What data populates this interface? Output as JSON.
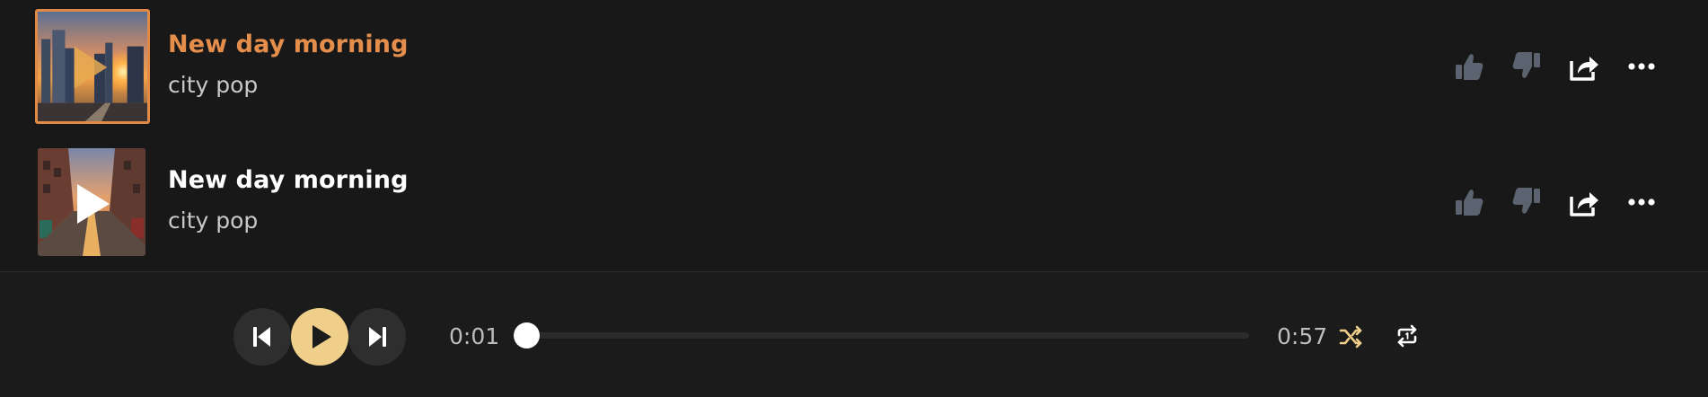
{
  "tracks": [
    {
      "title": "New day morning",
      "subtitle": "city pop",
      "active": true,
      "thumbnail_icon": "sunset-city-skyline-art"
    },
    {
      "title": "New day morning",
      "subtitle": "city pop",
      "active": false,
      "thumbnail_icon": "sunset-street-art"
    }
  ],
  "row_actions": [
    "thumbs-up-icon",
    "thumbs-down-icon",
    "share-icon",
    "more-icon"
  ],
  "player": {
    "current_time": "0:01",
    "total_time": "0:57",
    "progress_fraction": 0.0,
    "buttons": [
      "previous-icon",
      "play-icon",
      "next-icon"
    ],
    "shuffle_icon": "shuffle-icon",
    "repeat_icon": "repeat-one-icon"
  },
  "colors": {
    "background": "#181818",
    "accent_orange": "#e58e4c",
    "play_button": "#f0cf8a",
    "action_icon": "#5c6370",
    "shuffle_icon": "#f0cf8a"
  }
}
